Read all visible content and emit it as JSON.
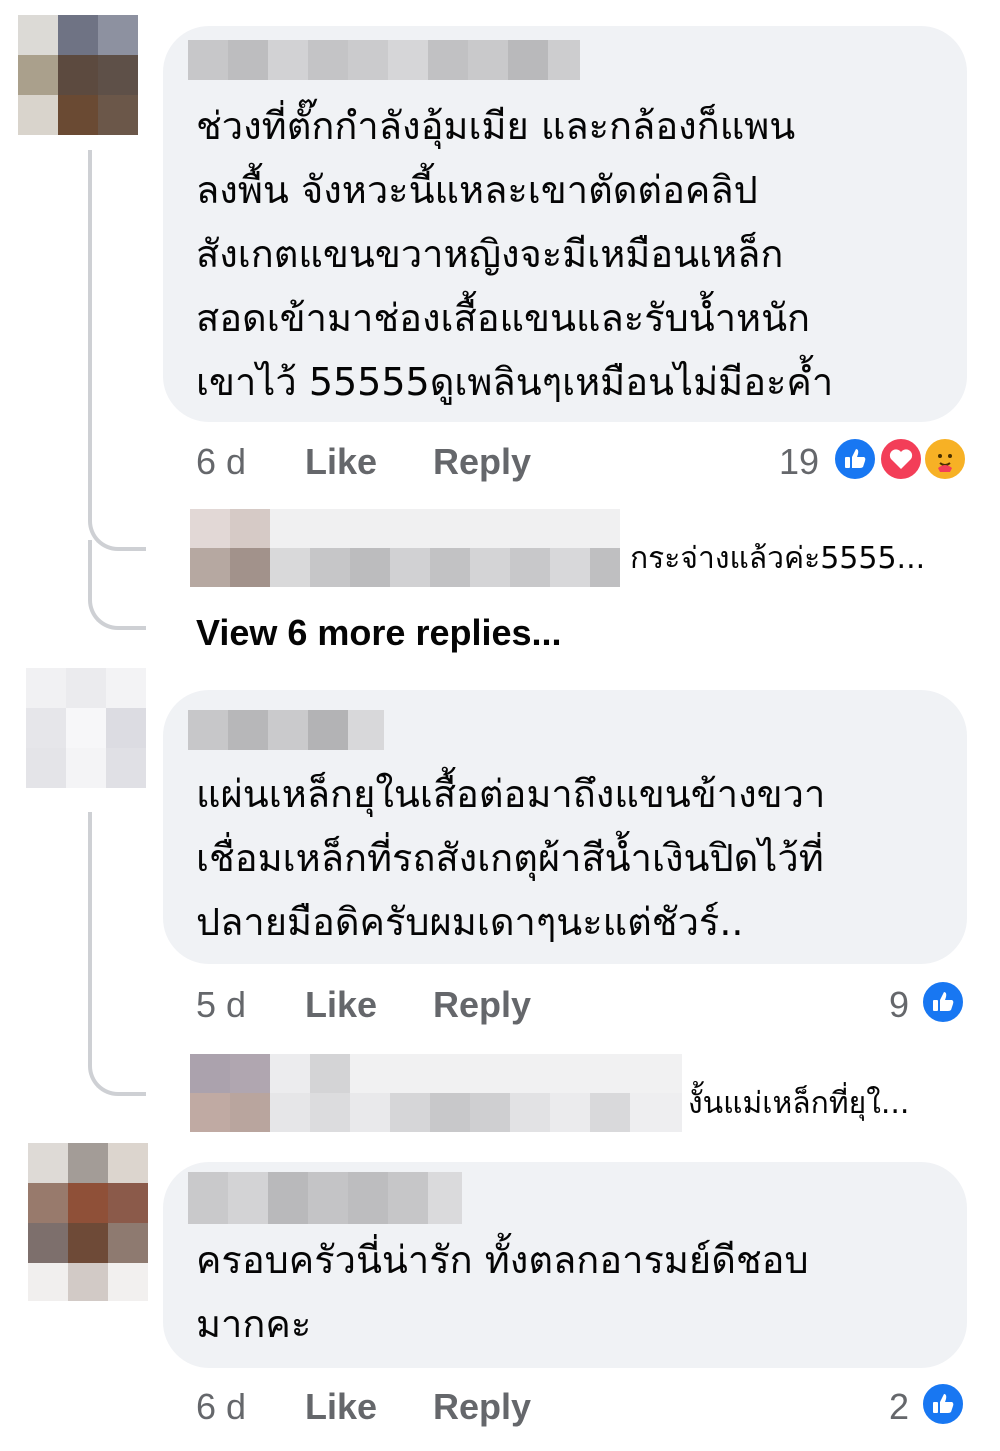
{
  "comments": [
    {
      "text": "ช่วงที่ตั๊กกำลังอุ้มเมีย และกล้องก็แพน\nลงพื้น จังหวะนี้แหละเขาตัดต่อคลิป\nสังเกตแขนขวาหญิงจะมีเหมือนเหล็ก\nสอดเข้ามาช่องเสื้อแขนและรับน้ำหนัก\nเขาไว้  55555ดูเพลินๆเหมือนไม่มีอะค้ำ",
      "time": "6 d",
      "like": "Like",
      "reply": "Reply",
      "reaction_count": "19",
      "reactions": [
        "like-icon",
        "love-icon",
        "care-icon"
      ],
      "reply_preview": "กระจ่างแล้วค่ะ5555...",
      "view_more": "View 6 more replies..."
    },
    {
      "text": "แผ่นเหล็กยุในเสื้อต่อมาถึงแขนข้างขวา\nเชื่อมเหล็กที่รถสังเกตุผ้าสีน้ำเงินปิดไว้ที่\nปลายมือดิครับผมเดาๆนะแต่ชัวร์..",
      "time": "5 d",
      "like": "Like",
      "reply": "Reply",
      "reaction_count": "9",
      "reactions": [
        "like-icon"
      ],
      "reply_preview": "งั้นแม่เหล็กที่ยุใ..."
    },
    {
      "text": "ครอบครัวนี่น่ารัก ทั้งตลกอารมย์ดีชอบ\nมากคะ",
      "time": "6 d",
      "like": "Like",
      "reply": "Reply",
      "reaction_count": "2",
      "reactions": [
        "like-icon"
      ]
    }
  ],
  "colors": {
    "bubble": "#f0f2f5",
    "secondary_text": "#65676b",
    "like_blue": "#1877f2",
    "love_red": "#f33e58",
    "care_yellow": "#f7b125"
  }
}
